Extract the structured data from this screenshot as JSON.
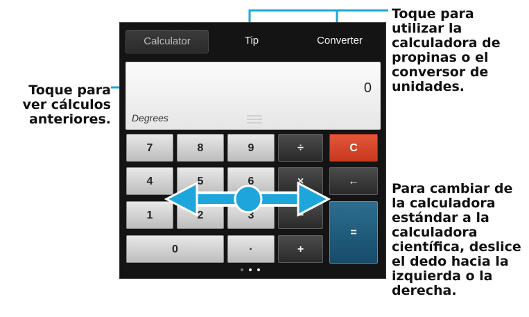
{
  "tabs": [
    {
      "label": "Calculator",
      "active": true
    },
    {
      "label": "Tip"
    },
    {
      "label": "Converter"
    }
  ],
  "display": {
    "value": "0",
    "mode": "Degrees"
  },
  "keys": {
    "k7": "7",
    "k8": "8",
    "k9": "9",
    "divide": "÷",
    "clear": "C",
    "k4": "4",
    "k5": "5",
    "k6": "6",
    "multiply": "×",
    "back": "←",
    "k1": "1",
    "k2": "2",
    "k3": "3",
    "minus": "−",
    "equals": "=",
    "k0": "0",
    "dot": "·",
    "plus": "+"
  },
  "callouts": {
    "tabs": "Toque para utilizar la calculadora de propinas o el conversor de unidades.",
    "history": "Toque para ver cálculos anteriores.",
    "swipe": "Para cambiar de la calculadora estándar a la calculadora científica, deslice el dedo hacia la izquierda o la derecha."
  },
  "colors": {
    "accent_blue": "#1ea6dc",
    "clear_key": "#d9472b",
    "equals_key": "#1a5576"
  }
}
